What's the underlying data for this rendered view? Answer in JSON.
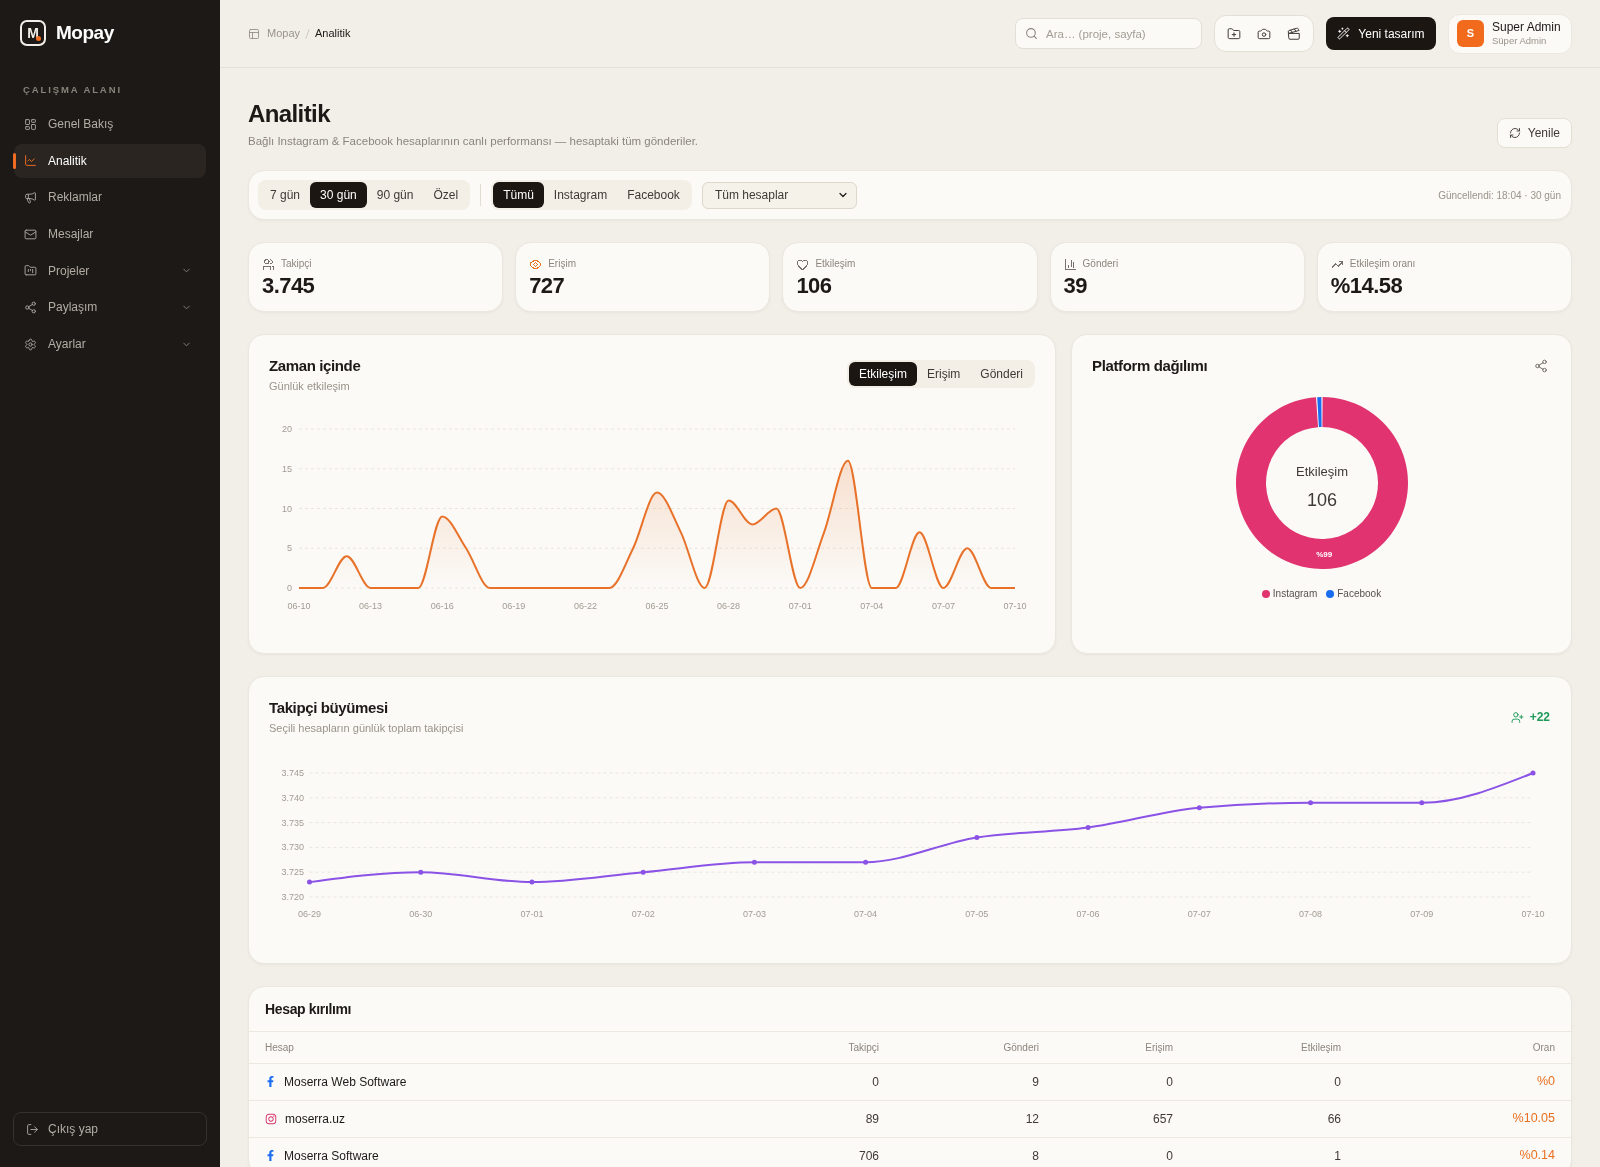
{
  "sidebar": {
    "brand": {
      "mark": "M",
      "name": "Mopay"
    },
    "section_label": "ÇALIŞMA ALANI",
    "items": [
      {
        "label": "Genel Bakış",
        "selected": false
      },
      {
        "label": "Analitik",
        "selected": true
      },
      {
        "label": "Reklamlar",
        "selected": false
      },
      {
        "label": "Mesajlar",
        "selected": false
      },
      {
        "label": "Projeler",
        "selected": false,
        "expanded": false
      },
      {
        "label": "Paylaşım",
        "selected": false,
        "expanded": false
      },
      {
        "label": "Ayarlar",
        "selected": false,
        "expanded": false
      }
    ],
    "logout_button": "Çıkış yap"
  },
  "top_bar": {
    "breadcrumb": [
      "Mopay",
      "Analitik"
    ],
    "search": {
      "placeholder": "Ara… (proje, sayfa)"
    },
    "new_design_button": "Yeni tasarım",
    "user": {
      "initial": "S",
      "name": "Super Admin",
      "role": "Süper Admin"
    }
  },
  "page_header": {
    "title": "Analitik",
    "subtitle": "Bağlı Instagram & Facebook hesaplarının canlı performansı — hesaptaki tüm gönderiler.",
    "refresh_button": "Yenile"
  },
  "filters": {
    "ranges": [
      {
        "label": "7 gün",
        "selected": false
      },
      {
        "label": "30 gün",
        "selected": true
      },
      {
        "label": "90 gün",
        "selected": false
      },
      {
        "label": "Özel",
        "selected": false
      }
    ],
    "platforms": [
      {
        "label": "Tümü",
        "selected": true
      },
      {
        "label": "Instagram",
        "selected": false
      },
      {
        "label": "Facebook",
        "selected": false
      }
    ],
    "account_select": {
      "value": "Tüm hesaplar"
    },
    "updated": "Güncellendi: 18:04 · 30 gün"
  },
  "stats": [
    {
      "label": "Takipçi",
      "value": "3.745",
      "color": "#78716c"
    },
    {
      "label": "Erişim",
      "value": "727",
      "color": "#e8772e"
    },
    {
      "label": "Etkileşim",
      "value": "106",
      "color": "#78716c"
    },
    {
      "label": "Gönderi",
      "value": "39",
      "color": "#78716c"
    },
    {
      "label": "Etkileşim oranı",
      "value": "%14.58",
      "color": "#78716c"
    }
  ],
  "timeline_card": {
    "title": "Zaman içinde",
    "subtitle": "Günlük etkileşim",
    "tabs": [
      {
        "label": "Etkileşim",
        "selected": true
      },
      {
        "label": "Erişim",
        "selected": false
      },
      {
        "label": "Gönderi",
        "selected": false
      }
    ],
    "chart_data": {
      "type": "area",
      "categories": [
        "06-10",
        null,
        null,
        "06-13",
        null,
        null,
        "06-16",
        null,
        null,
        "06-19",
        null,
        null,
        "06-22",
        null,
        null,
        "06-25",
        null,
        null,
        "06-28",
        null,
        null,
        "07-01",
        null,
        null,
        "07-04",
        null,
        null,
        "07-07",
        null,
        null,
        "07-10"
      ],
      "series": [
        {
          "color": "#e8722a",
          "values": [
            0,
            0,
            4,
            0,
            0,
            0,
            9,
            5,
            0,
            0,
            0,
            0,
            0,
            0,
            5,
            12,
            7,
            0,
            11,
            8,
            10,
            0,
            7,
            16,
            0,
            0,
            7,
            0,
            5,
            0,
            0
          ]
        }
      ],
      "ylim": [
        0,
        20
      ],
      "yticks": [
        0,
        5,
        10,
        15,
        20
      ],
      "grid": true
    }
  },
  "platform_card": {
    "title": "Platform dağılımı",
    "center_label": "Etkileşim",
    "center_value": "106",
    "chart_data": {
      "type": "donut",
      "categories": [
        "Instagram",
        "Facebook"
      ],
      "values": [
        99,
        1
      ],
      "colors": [
        "#e0336f",
        "#1a6cf0"
      ],
      "value_labels": [
        "%99",
        null
      ]
    }
  },
  "follower_card": {
    "title": "Takipçi büyümesi",
    "subtitle": "Seçili hesapların günlük toplam takipçisi",
    "growth": "+22",
    "chart_data": {
      "type": "line",
      "categories": [
        "06-29",
        "06-30",
        "07-01",
        "07-02",
        "07-03",
        "07-04",
        "07-05",
        "07-06",
        "07-07",
        "07-08",
        "07-09",
        "07-10"
      ],
      "series": [
        {
          "color": "#8b52e6",
          "values": [
            3.723,
            3.725,
            3.723,
            3.725,
            3.727,
            3.727,
            3.732,
            3.734,
            3.738,
            3.739,
            3.739,
            3.745
          ]
        }
      ],
      "ylim": [
        3.72,
        3.745
      ],
      "yticks": [
        {
          "value": 3.72,
          "label": "3.720"
        },
        {
          "value": 3.725,
          "label": "3.725"
        },
        {
          "value": 3.73,
          "label": "3.730"
        },
        {
          "value": 3.735,
          "label": "3.735"
        },
        {
          "value": 3.74,
          "label": "3.740"
        },
        {
          "value": 3.745,
          "label": "3.745"
        }
      ],
      "grid": true
    }
  },
  "accounts_table": {
    "title": "Hesap kırılımı",
    "columns": [
      "Hesap",
      "Takipçi",
      "Gönderi",
      "Erişim",
      "Etkileşim",
      "Oran"
    ],
    "rows": [
      {
        "kind": "facebook",
        "cells": [
          "Moserra Web Software",
          "0",
          "9",
          "0",
          "0",
          "%0"
        ]
      },
      {
        "kind": "instagram",
        "cells": [
          "moserra.uz",
          "89",
          "12",
          "657",
          "66",
          "%10.05"
        ]
      },
      {
        "kind": "facebook",
        "cells": [
          "Moserra Software",
          "706",
          "8",
          "0",
          "1",
          "%0.14"
        ]
      }
    ]
  }
}
